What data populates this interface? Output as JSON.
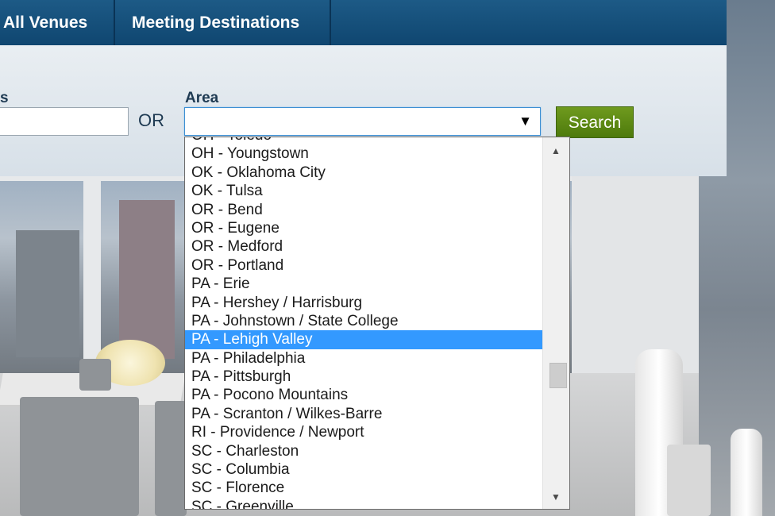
{
  "nav": {
    "items": [
      {
        "label": "All Venues"
      },
      {
        "label": "Meeting Destinations"
      }
    ]
  },
  "search": {
    "left_label_fragment": "s",
    "keyword_value": "",
    "or_text": "OR",
    "area_label": "Area",
    "area_value": "",
    "search_button": "Search"
  },
  "dropdown": {
    "options": [
      "OH - Toledo",
      "OH - Youngstown",
      "OK - Oklahoma City",
      "OK - Tulsa",
      "OR - Bend",
      "OR - Eugene",
      "OR - Medford",
      "OR - Portland",
      "PA - Erie",
      "PA - Hershey / Harrisburg",
      "PA - Johnstown / State College",
      "PA - Lehigh Valley",
      "PA - Philadelphia",
      "PA - Pittsburgh",
      "PA - Pocono Mountains",
      "PA - Scranton / Wilkes-Barre",
      "RI - Providence / Newport",
      "SC - Charleston",
      "SC - Columbia",
      "SC - Florence",
      "SC - Greenville"
    ],
    "highlighted": "PA - Lehigh Valley",
    "scroll_up_icon": "triangle-up-icon",
    "scroll_down_icon": "triangle-down-icon"
  },
  "colors": {
    "nav_bg": "#0f4670",
    "search_button": "#5a8614",
    "selection": "#3399ff"
  }
}
